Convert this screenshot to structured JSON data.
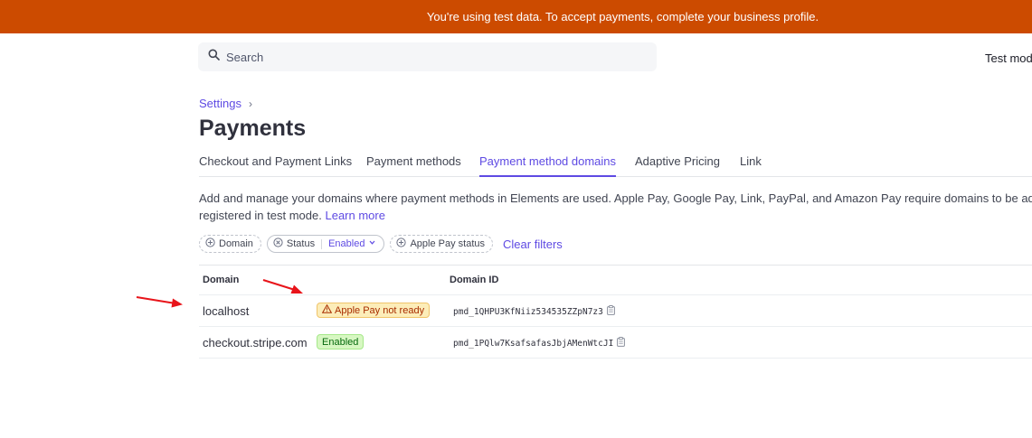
{
  "banner": {
    "text": "You're using test data. To accept payments, complete your business profile."
  },
  "search": {
    "placeholder": "Search",
    "icon": "search-icon"
  },
  "header": {
    "mode_label": "Test mod"
  },
  "breadcrumb": {
    "parent": "Settings",
    "separator": "›"
  },
  "page": {
    "title": "Payments"
  },
  "tabs": [
    {
      "label": "Checkout and Payment Links",
      "active": false
    },
    {
      "label": "Payment methods",
      "active": false
    },
    {
      "label": "Payment method domains",
      "active": true
    },
    {
      "label": "Adaptive Pricing",
      "active": false
    },
    {
      "label": "Link",
      "active": false
    }
  ],
  "description": {
    "line1": "Add and manage your domains where payment methods in Elements are used. Apple Pay, Google Pay, Link, PayPal, and Amazon Pay require domains to be added. Do",
    "line2": "registered in test mode.",
    "learn_more": "Learn more"
  },
  "filters": {
    "domain": "Domain",
    "status": "Status",
    "status_value": "Enabled",
    "apple_pay_status": "Apple Pay status",
    "clear": "Clear filters"
  },
  "table": {
    "columns": {
      "domain": "Domain",
      "domain_id": "Domain ID"
    },
    "rows": [
      {
        "domain": "localhost",
        "badge": "Apple Pay not ready",
        "badge_type": "warning",
        "domain_id": "pmd_1QHPU3KfNiiz534535ZZpN7z3"
      },
      {
        "domain": "checkout.stripe.com",
        "badge": "Enabled",
        "badge_type": "success",
        "domain_id": "pmd_1PQlw7KsafsafasJbjAMenWtcJI"
      }
    ]
  },
  "colors": {
    "banner": "#cc4b00",
    "accent": "#5e4ae3",
    "annotation_arrow": "#e8141a"
  }
}
